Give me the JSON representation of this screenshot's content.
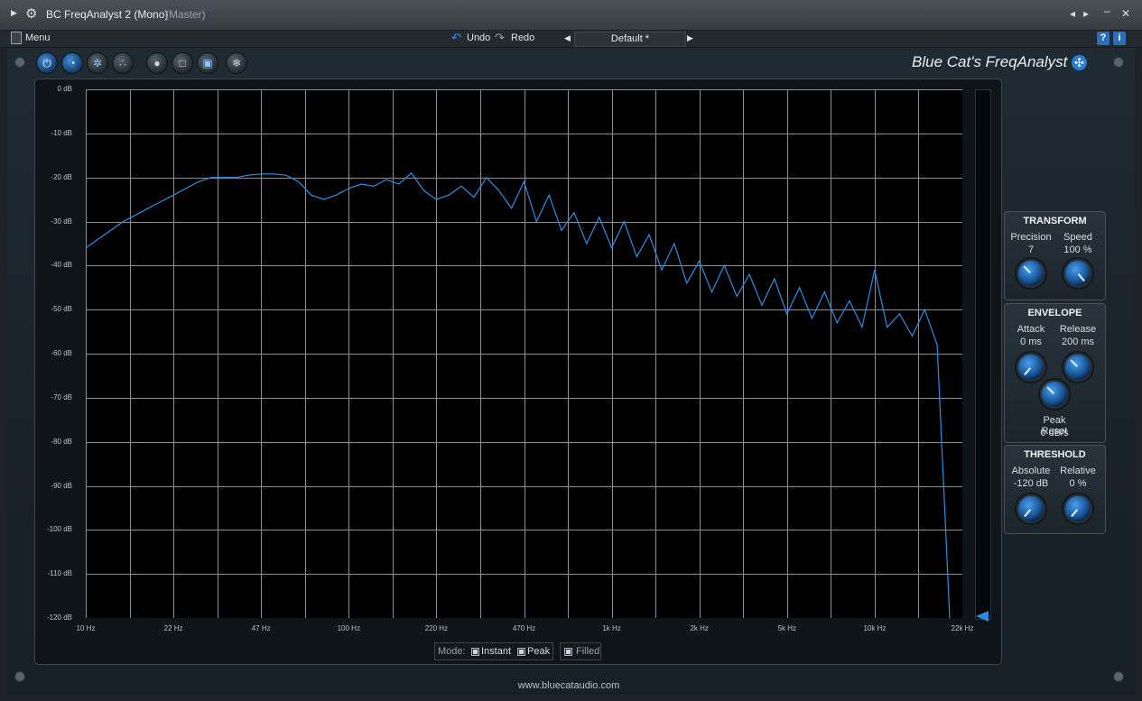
{
  "window": {
    "title": "BC FreqAnalyst 2 (Mono)",
    "subtitle": "(Master)",
    "buttons": [
      "◂",
      "▸",
      "–",
      "✕"
    ]
  },
  "menubar": {
    "menu": "Menu",
    "undo": "Undo",
    "redo": "Redo",
    "preset": "Default *",
    "help": "?",
    "info": "i"
  },
  "brand": "Blue Cat's FreqAnalyst",
  "graph": {
    "y_labels": [
      "0 dB",
      "-10 dB",
      "-20 dB",
      "-30 dB",
      "-40 dB",
      "-50 dB",
      "-60 dB",
      "-70 dB",
      "-80 dB",
      "-90 dB",
      "-100 dB",
      "-110 dB",
      "-120 dB"
    ],
    "x_labels": [
      "10 Hz",
      "22 Hz",
      "47 Hz",
      "100 Hz",
      "220 Hz",
      "470 Hz",
      "1k Hz",
      "2k Hz",
      "5k Hz",
      "10k Hz",
      "22k Hz"
    ],
    "line_color": "#2f8fe0",
    "grid_color": "#ffffff",
    "spectrum_db": [
      -36,
      -34,
      -32,
      -30,
      -28.5,
      -27,
      -25.5,
      -24,
      -22.5,
      -21,
      -20,
      -20,
      -20,
      -19.5,
      -19.2,
      -19.2,
      -19.5,
      -21,
      -24,
      -25,
      -24,
      -22.5,
      -21.5,
      -22,
      -20.5,
      -21.5,
      -19,
      -23,
      -25,
      -24,
      -22,
      -24.5,
      -20,
      -23,
      -27,
      -21,
      -30,
      -24,
      -32,
      -28,
      -35,
      -29,
      -36,
      -30,
      -38,
      -33,
      -41,
      -35,
      -44,
      -39,
      -46,
      -40,
      -47,
      -42,
      -49,
      -43,
      -51,
      -45,
      -52,
      -46,
      -53,
      -48,
      -54,
      -41,
      -54,
      -51,
      -56,
      -50,
      -58,
      -120
    ]
  },
  "mode": {
    "label": "Mode:",
    "instant": "Instant",
    "peak": "Peak",
    "filled": "Filled"
  },
  "website": "www.bluecataudio.com",
  "panels": {
    "transform": {
      "title": "TRANSFORM",
      "precision_label": "Precision",
      "precision_value": "7",
      "speed_label": "Speed",
      "speed_value": "100 %"
    },
    "envelope": {
      "title": "ENVELOPE",
      "attack_label": "Attack",
      "attack_value": "0 ms",
      "release_label": "Release",
      "release_value": "200 ms",
      "peak_reset_label": "Peak Reset",
      "peak_reset_value": "0 dB/s"
    },
    "threshold": {
      "title": "THRESHOLD",
      "absolute_label": "Absolute",
      "absolute_value": "-120 dB",
      "relative_label": "Relative",
      "relative_value": "0 %"
    }
  }
}
